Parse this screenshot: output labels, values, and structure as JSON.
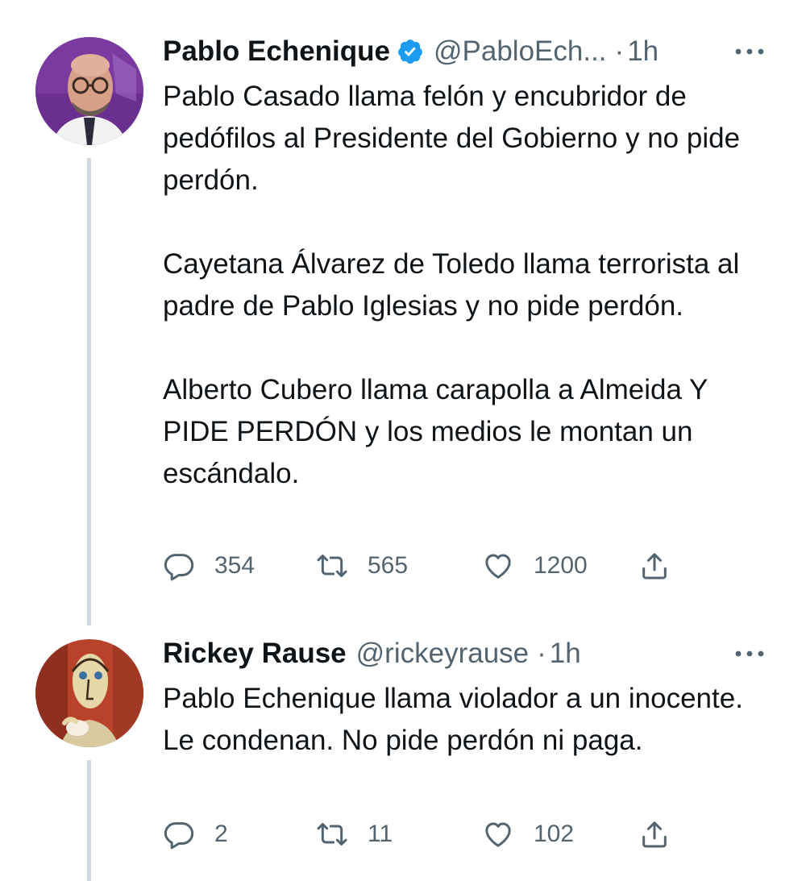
{
  "colors": {
    "text_primary": "#0f1419",
    "text_secondary": "#536471",
    "verified_blue": "#1d9bf0",
    "thread_line": "#cfd9de"
  },
  "tweets": [
    {
      "name": "Pablo Echenique",
      "verified": true,
      "handle": "@PabloEch...",
      "separator": "·",
      "time": "1h",
      "avatar_icon": "avatar-photo-icon",
      "paragraphs": [
        "Pablo Casado llama felón y encubridor de pedófilos al Presidente del Gobierno y no pide perdón.",
        "Cayetana Álvarez de Toledo llama terrorista al padre de Pablo Iglesias y no pide perdón.",
        "Alberto Cubero llama carapolla a Almeida Y PIDE PERDÓN y los medios le montan un escándalo."
      ],
      "replies": "354",
      "retweets": "565",
      "likes": "1200"
    },
    {
      "name": "Rickey Rause",
      "verified": false,
      "handle": "@rickeyrause",
      "separator": "·",
      "time": "1h",
      "avatar_icon": "avatar-painting-icon",
      "paragraphs": [
        "Pablo Echenique llama violador a un inocente. Le condenan. No pide perdón ni paga."
      ],
      "replies": "2",
      "retweets": "11",
      "likes": "102"
    }
  ]
}
